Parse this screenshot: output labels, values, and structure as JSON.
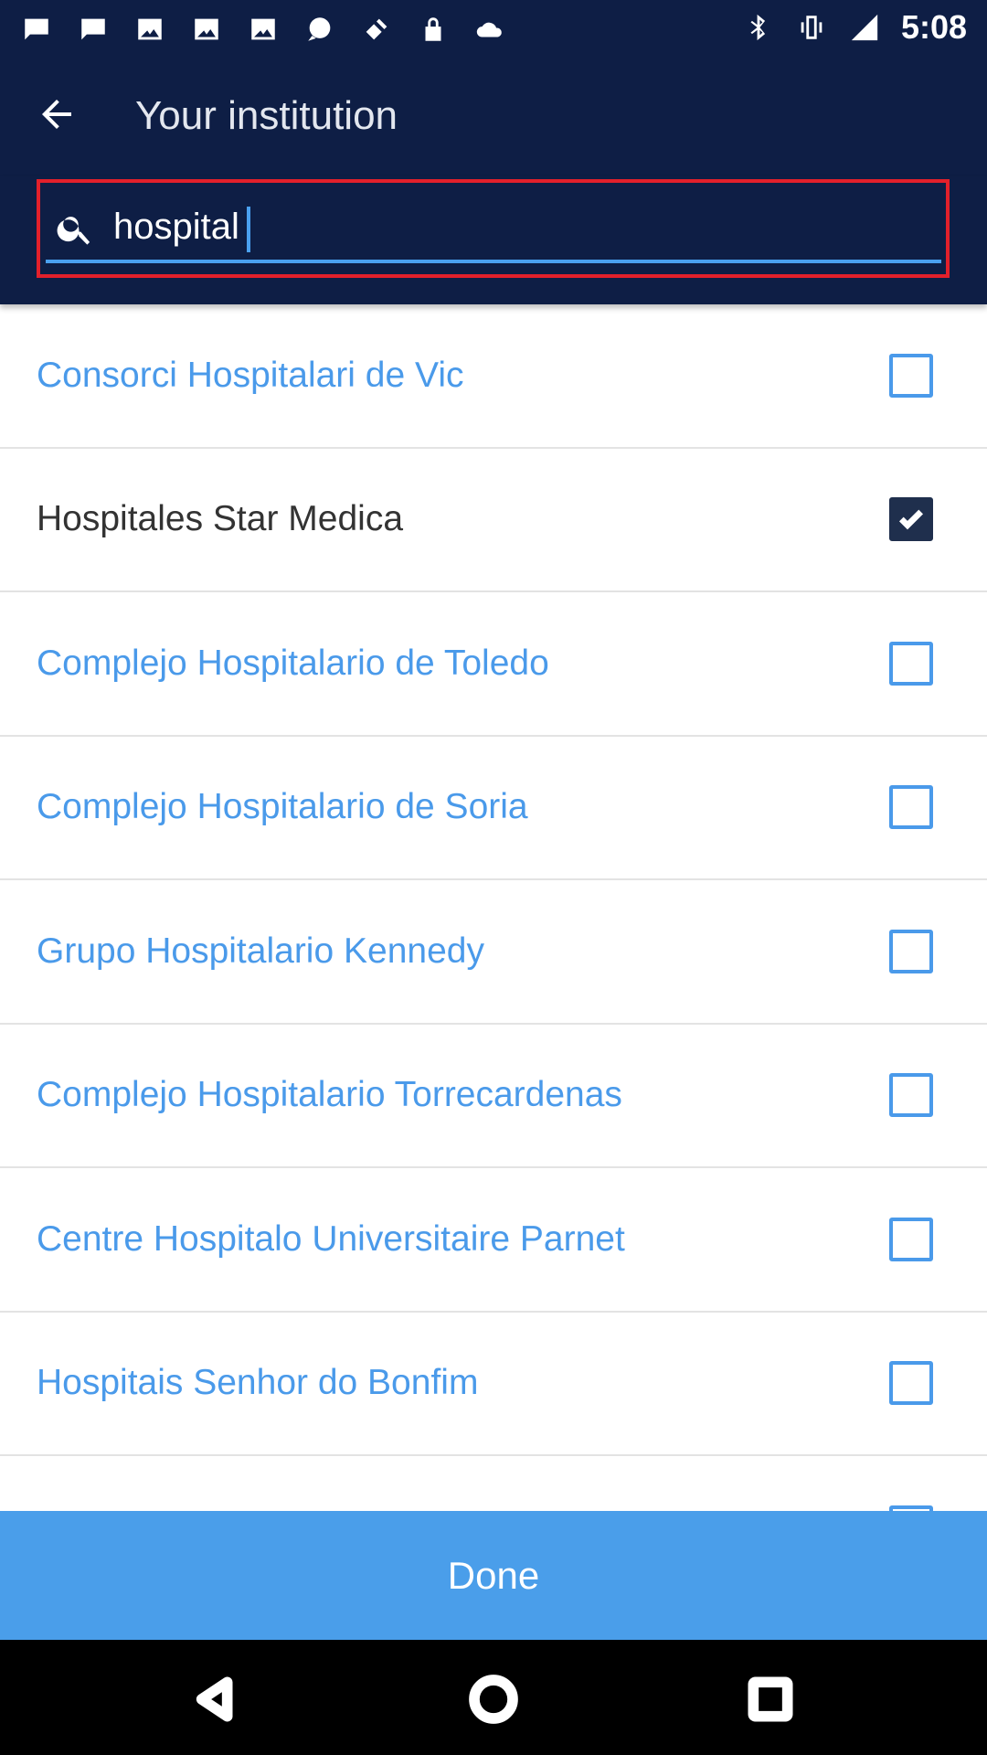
{
  "status_bar": {
    "time": "5:08",
    "left_icons": [
      "message-icon",
      "message-icon",
      "image-icon",
      "image-icon",
      "image-icon",
      "chat-icon",
      "fake-gps-icon",
      "lock-icon",
      "cloud-icon"
    ],
    "right_icons": [
      "bluetooth-icon",
      "vibrate-icon",
      "signal-icon"
    ]
  },
  "app_bar": {
    "back_icon": "arrow-back-icon",
    "title": "Your institution"
  },
  "search": {
    "icon": "search-icon",
    "value": "hospital",
    "highlight_color": "#e2202b",
    "underline_color": "#4aa0f0"
  },
  "list": {
    "items": [
      {
        "label": "Consorci Hospitalari de Vic",
        "checked": false
      },
      {
        "label": "Hospitales Star Medica",
        "checked": true
      },
      {
        "label": "Complejo Hospitalario de Toledo",
        "checked": false
      },
      {
        "label": "Complejo Hospitalario de Soria",
        "checked": false
      },
      {
        "label": "Grupo Hospitalario Kennedy",
        "checked": false
      },
      {
        "label": "Complejo Hospitalario Torrecardenas",
        "checked": false
      },
      {
        "label": "Centre Hospitalo Universitaire Parnet",
        "checked": false
      },
      {
        "label": "Hospitais Senhor do Bonfim",
        "checked": false
      }
    ]
  },
  "done_button": {
    "label": "Done"
  },
  "nav_bar": {
    "icons": [
      "back-triangle-icon",
      "home-circle-icon",
      "recents-square-icon"
    ]
  },
  "colors": {
    "header_bg": "#0e1e45",
    "accent": "#4a9eea",
    "selected_text": "#333333",
    "checked_box": "#1f2f4d"
  }
}
